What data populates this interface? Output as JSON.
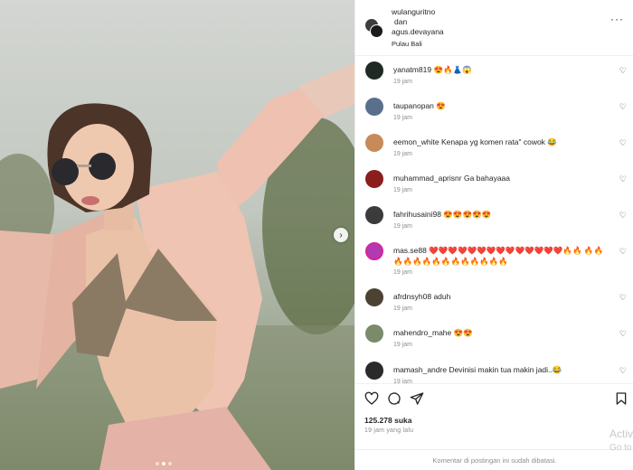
{
  "post": {
    "author": "wulanguritno",
    "connector": "dan",
    "coauthor": "agus.devayana",
    "location": "Pulau Bali",
    "likes": "125.278 suka",
    "posted": "19 jam yang lalu",
    "comments_closed": "Komentar di postingan ini sudah dibatasi."
  },
  "comments": [
    {
      "user": "yanatm819",
      "text": "😍🔥👗😱",
      "time": "19 jam",
      "avatar_color": "#1f2a24"
    },
    {
      "user": "taupanopan",
      "text": "😍",
      "time": "19 jam",
      "avatar_color": "#5a6f8c"
    },
    {
      "user": "eemon_white",
      "text": "Kenapa yg komen rata\" cowok 😂",
      "time": "19 jam",
      "avatar_color": "#c78a5a"
    },
    {
      "user": "muhammad_aprisnr",
      "text": "Ga bahayaaa",
      "time": "19 jam",
      "avatar_color": "#8b1d1d"
    },
    {
      "user": "fahrihusaini98",
      "text": "😍😍😍😍😍",
      "time": "19 jam",
      "avatar_color": "#3b3b3b"
    },
    {
      "user": "mas.se88",
      "text": "❤️❤️❤️❤️❤️❤️❤️❤️❤️❤️❤️❤️❤️❤️🔥🔥 🔥🔥🔥🔥🔥🔥🔥🔥🔥🔥🔥🔥🔥🔥",
      "time": "19 jam",
      "avatar_color": "#b23ab0"
    },
    {
      "user": "afrdnsyh08",
      "text": "aduh",
      "time": "19 jam",
      "avatar_color": "#4b4232"
    },
    {
      "user": "mahendro_mahe",
      "text": "😍😍",
      "time": "19 jam",
      "avatar_color": "#7a8a6a"
    },
    {
      "user": "mamash_andre",
      "text": "Devinisi makin tua makin jadi..😂",
      "time": "19 jam",
      "avatar_color": "#2a2a2a"
    }
  ],
  "watermark": {
    "line1": "Activ",
    "line2": "Go to"
  },
  "icons": {
    "like": "heart-icon",
    "comment": "comment-icon",
    "share": "send-icon",
    "save": "bookmark-icon",
    "more": "more-icon",
    "next": "chevron-right-icon"
  }
}
